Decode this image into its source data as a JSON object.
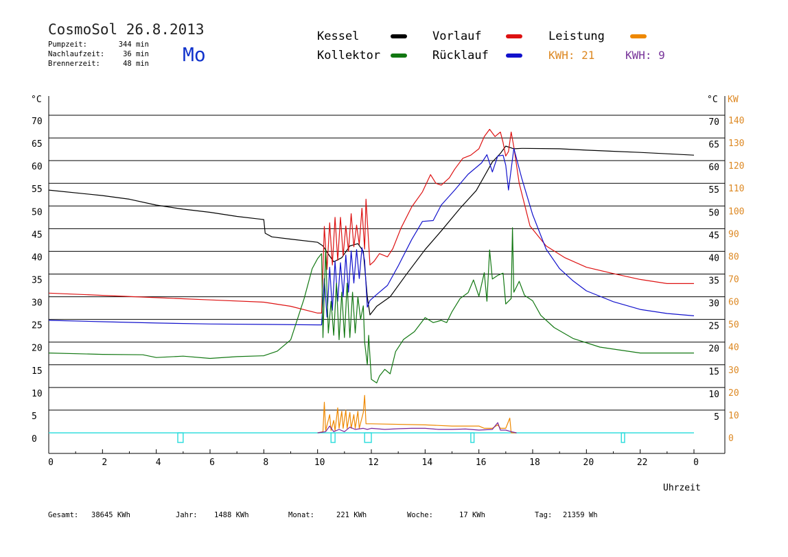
{
  "header": {
    "title": "CosmoSol 26.8.2013",
    "day": "Mo",
    "stats": [
      {
        "label": "Pumpzeit:",
        "value": "344 min"
      },
      {
        "label": "Nachlaufzeit:",
        "value": "36 min"
      },
      {
        "label": "Brennerzeit:",
        "value": "48 min"
      }
    ]
  },
  "legend": {
    "kessel": "Kessel",
    "vorlauf": "Vorlauf",
    "leistung": "Leistung",
    "kollektor": "Kollektor",
    "ruecklauf": "Rücklauf",
    "kwh1": "KWH: 21",
    "kwh2": "KWH: 9"
  },
  "axes": {
    "left_unit": "°C",
    "right_unit_c": "°C",
    "right_unit_kw": "KW",
    "x_label": "Uhrzeit"
  },
  "footer": [
    {
      "label": "Gesamt:",
      "value": "38645 KWh"
    },
    {
      "label": "Jahr:",
      "value": "1488 KWh"
    },
    {
      "label": "Monat:",
      "value": "221 KWh"
    },
    {
      "label": "Woche:",
      "value": "17 KWh"
    },
    {
      "label": "Tag:",
      "value": "21359 Wh"
    }
  ],
  "colors": {
    "kessel": "#000000",
    "vorlauf": "#dd1111",
    "ruecklauf": "#1111cc",
    "kollektor": "#117711",
    "leistung": "#ee8800",
    "kwh2": "#772299",
    "pump": "#33dddd",
    "kwh1_text": "#dd8822",
    "kwh2_text": "#773399",
    "day": "#1133cc"
  },
  "chart_data": {
    "type": "line",
    "x_range": [
      0,
      24
    ],
    "y_range_celsius": [
      0,
      70
    ],
    "y_range_kw": [
      0,
      140
    ],
    "x_ticks": [
      "0",
      "2",
      "4",
      "6",
      "8",
      "10",
      "12",
      "14",
      "16",
      "18",
      "20",
      "22",
      "0"
    ],
    "y_ticks_left": [
      "0",
      "5",
      "10",
      "15",
      "20",
      "25",
      "30",
      "35",
      "40",
      "45",
      "50",
      "55",
      "60",
      "65",
      "70"
    ],
    "y_ticks_right_c": [
      "5",
      "10",
      "15",
      "20",
      "25",
      "30",
      "35",
      "40",
      "45",
      "50",
      "55",
      "60",
      "65",
      "70"
    ],
    "y_ticks_right_kw": [
      "0",
      "10",
      "20",
      "30",
      "40",
      "50",
      "60",
      "70",
      "80",
      "90",
      "100",
      "110",
      "120",
      "130",
      "140"
    ],
    "series": [
      {
        "name": "Kessel",
        "color_key": "kessel",
        "points": [
          [
            0,
            53.5
          ],
          [
            2,
            52.3
          ],
          [
            3,
            51.5
          ],
          [
            4,
            50.2
          ],
          [
            5,
            49.3
          ],
          [
            6,
            48.6
          ],
          [
            7,
            47.7
          ],
          [
            8,
            47
          ],
          [
            8.05,
            44
          ],
          [
            8.3,
            43.2
          ],
          [
            9,
            42.7
          ],
          [
            10,
            42
          ],
          [
            10.2,
            41.2
          ],
          [
            10.4,
            39.4
          ],
          [
            10.6,
            37.7
          ],
          [
            10.9,
            38.6
          ],
          [
            11.2,
            41.2
          ],
          [
            11.5,
            41.7
          ],
          [
            11.7,
            40
          ],
          [
            11.85,
            30
          ],
          [
            11.95,
            26
          ],
          [
            12.2,
            27.9
          ],
          [
            12.7,
            30
          ],
          [
            13.3,
            34.9
          ],
          [
            14,
            40.4
          ],
          [
            14.6,
            44.5
          ],
          [
            15.3,
            49.5
          ],
          [
            15.9,
            53.4
          ],
          [
            16.5,
            59.7
          ],
          [
            16.8,
            61.6
          ],
          [
            17,
            63.2
          ],
          [
            17.3,
            62.6
          ],
          [
            17.6,
            62.7
          ],
          [
            19,
            62.6
          ],
          [
            20,
            62.3
          ],
          [
            22,
            61.8
          ],
          [
            24,
            61.2
          ]
        ]
      },
      {
        "name": "Vorlauf",
        "color_key": "vorlauf",
        "points": [
          [
            0,
            30.8
          ],
          [
            2,
            30.3
          ],
          [
            4,
            29.8
          ],
          [
            6,
            29.3
          ],
          [
            8,
            28.8
          ],
          [
            9,
            27.9
          ],
          [
            10,
            26.4
          ],
          [
            10.15,
            26.4
          ],
          [
            10.25,
            45.5
          ],
          [
            10.35,
            36
          ],
          [
            10.45,
            46.3
          ],
          [
            10.55,
            37
          ],
          [
            10.65,
            47.5
          ],
          [
            10.75,
            38
          ],
          [
            10.85,
            47.5
          ],
          [
            10.95,
            39
          ],
          [
            11.05,
            45.6
          ],
          [
            11.15,
            40
          ],
          [
            11.25,
            48.3
          ],
          [
            11.35,
            41
          ],
          [
            11.45,
            45.8
          ],
          [
            11.55,
            41.5
          ],
          [
            11.65,
            49.5
          ],
          [
            11.75,
            40.5
          ],
          [
            11.8,
            51.5
          ],
          [
            11.95,
            37
          ],
          [
            12.1,
            37.8
          ],
          [
            12.3,
            39.5
          ],
          [
            12.6,
            38.8
          ],
          [
            12.8,
            40.6
          ],
          [
            13.1,
            45.1
          ],
          [
            13.5,
            49.8
          ],
          [
            13.9,
            53.1
          ],
          [
            14.2,
            56.9
          ],
          [
            14.4,
            55
          ],
          [
            14.6,
            54.6
          ],
          [
            14.9,
            56.2
          ],
          [
            15.1,
            58.1
          ],
          [
            15.4,
            60.5
          ],
          [
            15.7,
            61.2
          ],
          [
            16,
            62.6
          ],
          [
            16.2,
            65.3
          ],
          [
            16.4,
            66.9
          ],
          [
            16.6,
            65.3
          ],
          [
            16.8,
            66.3
          ],
          [
            16.9,
            64
          ],
          [
            17,
            61
          ],
          [
            17.1,
            62
          ],
          [
            17.2,
            66.3
          ],
          [
            17.3,
            63
          ],
          [
            17.5,
            55
          ],
          [
            17.9,
            45.6
          ],
          [
            18.5,
            41.2
          ],
          [
            19.2,
            38.6
          ],
          [
            20,
            36.5
          ],
          [
            21,
            35.1
          ],
          [
            22,
            33.8
          ],
          [
            23,
            32.9
          ],
          [
            24,
            32.9
          ]
        ]
      },
      {
        "name": "Rücklauf",
        "color_key": "ruecklauf",
        "points": [
          [
            0,
            24.8
          ],
          [
            2,
            24.5
          ],
          [
            4,
            24.2
          ],
          [
            6,
            24
          ],
          [
            8,
            23.9
          ],
          [
            10,
            23.8
          ],
          [
            10.15,
            23.8
          ],
          [
            10.25,
            34
          ],
          [
            10.35,
            25.5
          ],
          [
            10.45,
            36.5
          ],
          [
            10.55,
            27
          ],
          [
            10.65,
            37.9
          ],
          [
            10.75,
            29
          ],
          [
            10.85,
            37.5
          ],
          [
            10.95,
            30
          ],
          [
            11.05,
            39.2
          ],
          [
            11.15,
            31
          ],
          [
            11.25,
            40.1
          ],
          [
            11.35,
            33
          ],
          [
            11.45,
            40.4
          ],
          [
            11.55,
            34
          ],
          [
            11.65,
            40.8
          ],
          [
            11.75,
            38
          ],
          [
            11.85,
            27.7
          ],
          [
            11.95,
            29.2
          ],
          [
            12.2,
            30.5
          ],
          [
            12.6,
            32.5
          ],
          [
            13,
            36.8
          ],
          [
            13.5,
            42.6
          ],
          [
            13.9,
            46.6
          ],
          [
            14.3,
            46.8
          ],
          [
            14.6,
            50.2
          ],
          [
            15.1,
            53.5
          ],
          [
            15.6,
            57
          ],
          [
            16.1,
            59.5
          ],
          [
            16.3,
            61.3
          ],
          [
            16.5,
            57.5
          ],
          [
            16.7,
            61
          ],
          [
            16.9,
            61.2
          ],
          [
            17,
            59
          ],
          [
            17.1,
            53.5
          ],
          [
            17.3,
            62.7
          ],
          [
            17.6,
            56
          ],
          [
            18,
            48.1
          ],
          [
            18.5,
            40.5
          ],
          [
            19,
            36.2
          ],
          [
            19.5,
            33.5
          ],
          [
            20,
            31.3
          ],
          [
            21,
            28.9
          ],
          [
            22,
            27.2
          ],
          [
            23,
            26.3
          ],
          [
            24,
            25.8
          ]
        ]
      },
      {
        "name": "Kollektor",
        "color_key": "kollektor",
        "points": [
          [
            0,
            17.6
          ],
          [
            2,
            17.3
          ],
          [
            3.5,
            17.2
          ],
          [
            4,
            16.6
          ],
          [
            5,
            16.9
          ],
          [
            6,
            16.4
          ],
          [
            7,
            16.8
          ],
          [
            8,
            17
          ],
          [
            8.5,
            18
          ],
          [
            9,
            20.5
          ],
          [
            9.5,
            29.6
          ],
          [
            9.8,
            36.2
          ],
          [
            10,
            38.4
          ],
          [
            10.15,
            39.5
          ],
          [
            10.2,
            21
          ],
          [
            10.3,
            40.5
          ],
          [
            10.4,
            22
          ],
          [
            10.5,
            29
          ],
          [
            10.6,
            21.5
          ],
          [
            10.7,
            33
          ],
          [
            10.8,
            20.5
          ],
          [
            10.9,
            31
          ],
          [
            11,
            21
          ],
          [
            11.1,
            33
          ],
          [
            11.2,
            21
          ],
          [
            11.3,
            31
          ],
          [
            11.4,
            22
          ],
          [
            11.5,
            30
          ],
          [
            11.6,
            25
          ],
          [
            11.7,
            28
          ],
          [
            11.75,
            20
          ],
          [
            11.85,
            15
          ],
          [
            11.9,
            21.5
          ],
          [
            12,
            11.8
          ],
          [
            12.2,
            11
          ],
          [
            12.3,
            12.5
          ],
          [
            12.5,
            14
          ],
          [
            12.7,
            13
          ],
          [
            12.9,
            17.9
          ],
          [
            13.2,
            20.6
          ],
          [
            13.6,
            22.3
          ],
          [
            14,
            25.4
          ],
          [
            14.3,
            24.3
          ],
          [
            14.6,
            24.8
          ],
          [
            14.8,
            24.3
          ],
          [
            15,
            26.7
          ],
          [
            15.3,
            29.6
          ],
          [
            15.6,
            30.9
          ],
          [
            15.8,
            33.7
          ],
          [
            16,
            30.1
          ],
          [
            16.2,
            35.3
          ],
          [
            16.3,
            29
          ],
          [
            16.4,
            40.3
          ],
          [
            16.5,
            33.9
          ],
          [
            16.7,
            34.7
          ],
          [
            16.9,
            35.2
          ],
          [
            17,
            28.4
          ],
          [
            17.2,
            29.6
          ],
          [
            17.25,
            45.2
          ],
          [
            17.3,
            31
          ],
          [
            17.5,
            33.4
          ],
          [
            17.7,
            30.3
          ],
          [
            18,
            29.1
          ],
          [
            18.3,
            25.9
          ],
          [
            18.8,
            23.2
          ],
          [
            19.5,
            20.8
          ],
          [
            20.5,
            18.9
          ],
          [
            22,
            17.6
          ],
          [
            24,
            17.6
          ]
        ]
      },
      {
        "name": "Leistung",
        "color_key": "leistung",
        "kw": true,
        "points": [
          [
            10,
            0
          ],
          [
            10.2,
            0.5
          ],
          [
            10.25,
            13.5
          ],
          [
            10.3,
            1
          ],
          [
            10.45,
            8
          ],
          [
            10.5,
            1
          ],
          [
            10.6,
            5.5
          ],
          [
            10.65,
            1
          ],
          [
            10.75,
            11
          ],
          [
            10.8,
            2
          ],
          [
            10.9,
            9.5
          ],
          [
            10.95,
            2
          ],
          [
            11.05,
            10
          ],
          [
            11.1,
            2
          ],
          [
            11.2,
            9
          ],
          [
            11.25,
            2
          ],
          [
            11.35,
            8
          ],
          [
            11.4,
            2
          ],
          [
            11.5,
            9.5
          ],
          [
            11.55,
            2
          ],
          [
            11.7,
            9
          ],
          [
            11.75,
            16.5
          ],
          [
            11.8,
            4
          ],
          [
            11.9,
            4
          ],
          [
            12,
            4
          ],
          [
            14,
            3.5
          ],
          [
            15,
            3
          ],
          [
            16,
            3
          ],
          [
            16.2,
            2
          ],
          [
            16.5,
            2
          ],
          [
            16.7,
            3.5
          ],
          [
            16.8,
            2
          ],
          [
            17,
            2
          ],
          [
            17.15,
            6.5
          ],
          [
            17.2,
            0
          ],
          [
            17.4,
            0
          ]
        ]
      },
      {
        "name": "KWH2",
        "color_key": "kwh2",
        "kw": true,
        "points": [
          [
            10,
            0
          ],
          [
            10.3,
            0.5
          ],
          [
            10.45,
            3
          ],
          [
            10.6,
            0.5
          ],
          [
            10.8,
            1.5
          ],
          [
            11,
            0.5
          ],
          [
            11.2,
            2.5
          ],
          [
            11.4,
            1.5
          ],
          [
            11.7,
            2
          ],
          [
            11.85,
            1.5
          ],
          [
            12,
            2
          ],
          [
            12.5,
            1.5
          ],
          [
            13,
            1.8
          ],
          [
            13.5,
            2
          ],
          [
            14,
            2
          ],
          [
            14.5,
            1.5
          ],
          [
            15,
            1.5
          ],
          [
            15.5,
            1.7
          ],
          [
            16,
            1.2
          ],
          [
            16.5,
            1.5
          ],
          [
            16.7,
            4.5
          ],
          [
            16.8,
            1.2
          ],
          [
            17,
            1.2
          ],
          [
            17.2,
            0.5
          ],
          [
            17.4,
            0
          ]
        ]
      },
      {
        "name": "Pumpe",
        "color_key": "pump",
        "pump_blocks": [
          [
            4.8,
            5.0
          ],
          [
            10.5,
            10.65
          ],
          [
            11.75,
            12.0
          ],
          [
            15.7,
            15.82
          ],
          [
            21.3,
            21.42
          ]
        ]
      }
    ]
  }
}
